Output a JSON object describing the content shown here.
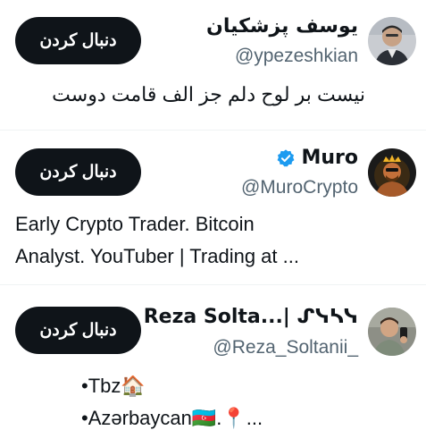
{
  "users": [
    {
      "display_name": "یوسف پزشکیان",
      "handle": "@ypezeshkian",
      "bio_lines": [
        "نیست بر لوح دلم جز الف قامت دوست"
      ],
      "follow_label": "دنبال کردن",
      "verified": false
    },
    {
      "display_name": "Muro",
      "handle": "@MuroCrypto",
      "bio_lines": [
        "Early Crypto Trader. Bitcoin",
        "Analyst. YouTuber | Trading at ..."
      ],
      "follow_label": "دنبال کردن",
      "verified": true
    },
    {
      "display_name": "Reza Solta...| ᔑᓭᓴᓭ",
      "handle": "@Reza_Soltanii_",
      "bio_lines": [
        "•Tbz🏠",
        "•Azərbaycan🇦🇿.📍..."
      ],
      "follow_label": "دنبال کردن",
      "verified": false
    }
  ],
  "colors": {
    "follow_bg": "#0f1419",
    "handle": "#536471",
    "verified": "#1d9bf0",
    "divider": "#eff3f4"
  },
  "icons": {
    "verified": "verified-badge-icon"
  }
}
